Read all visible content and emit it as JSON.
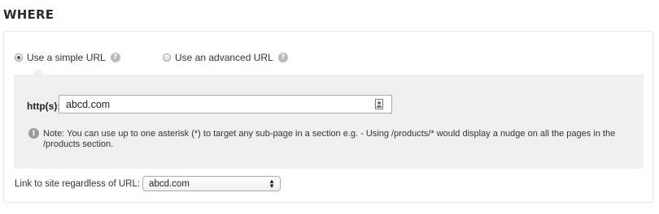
{
  "section": {
    "title": "WHERE"
  },
  "url_mode": {
    "simple_label": "Use a simple URL",
    "advanced_label": "Use an advanced URL",
    "selected": "simple",
    "help_glyph": "?"
  },
  "url": {
    "label": "http(s)://",
    "value": "abcd.com"
  },
  "note": {
    "icon_glyph": "i",
    "text": "Note: You can use up to one asterisk (*) to target any sub-page in a section e.g. - Using /products/* would display a nudge on all the pages in the /products section."
  },
  "link_site": {
    "label": "Link to site regardless of URL:",
    "selected": "abcd.com"
  }
}
